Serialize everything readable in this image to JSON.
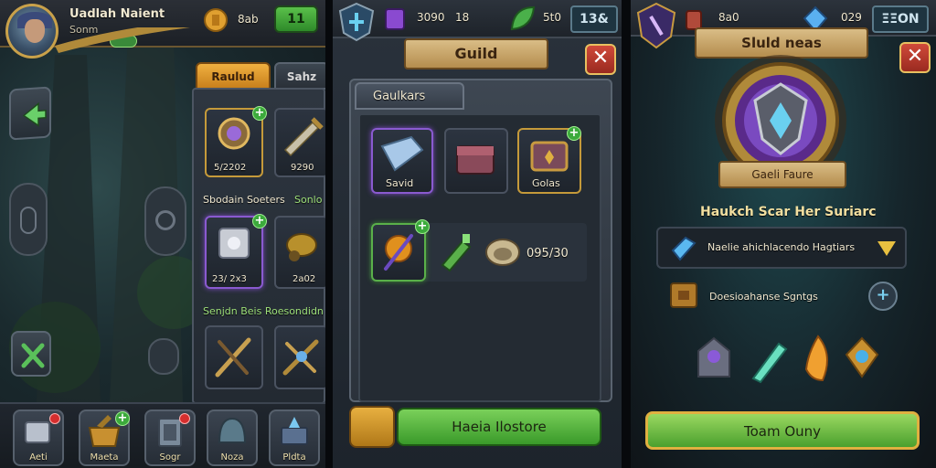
{
  "panel1": {
    "player_name": "Uadlah Naient",
    "player_sub": "Sonm",
    "gold_value": "8ab",
    "resource_button": "11",
    "tabs": [
      {
        "label": "Raulud"
      },
      {
        "label": "Sahz"
      }
    ],
    "items": [
      {
        "label": "5/2202"
      },
      {
        "label": "9290"
      },
      {
        "label": "23/ 2x3"
      },
      {
        "label": "2a02"
      }
    ],
    "section1_title": "Sbodain Soeters",
    "section1_aside": "Sonlo",
    "section2_title": "Senjdn Beis Roesondidn",
    "nav": [
      {
        "label": "Aeti"
      },
      {
        "label": "Maeta"
      },
      {
        "label": "Sogr"
      },
      {
        "label": "Noza"
      },
      {
        "label": "Pldta"
      }
    ]
  },
  "panel2": {
    "resource1": "3090",
    "resource1b": "18",
    "resource2": "5t0",
    "resource3": "13&",
    "title": "Guild",
    "tab": "Gaulkars",
    "slot_labels": [
      "Savid",
      "Golas"
    ],
    "count": "095/30",
    "cta": "Haeia Ilostore"
  },
  "panel3": {
    "resource1": "8a0",
    "resource2": "029",
    "resource3": "ΞΞON",
    "banner": "Sluld neas",
    "emblem_caption": "Gaeli Faure",
    "heading": "Haukch Scar Her Suriarc",
    "row1": "Naelie ahichlacendo Hagtiars",
    "row2": "Doesioahanse Sgntgs",
    "cta": "Toam Ouny"
  },
  "colors": {
    "gold": "#c9a14a",
    "green_button": "#4caf3a",
    "red_close": "#c03a2e",
    "purple_glow": "#8a5ad0",
    "banner_tan": "#d2b27a"
  }
}
